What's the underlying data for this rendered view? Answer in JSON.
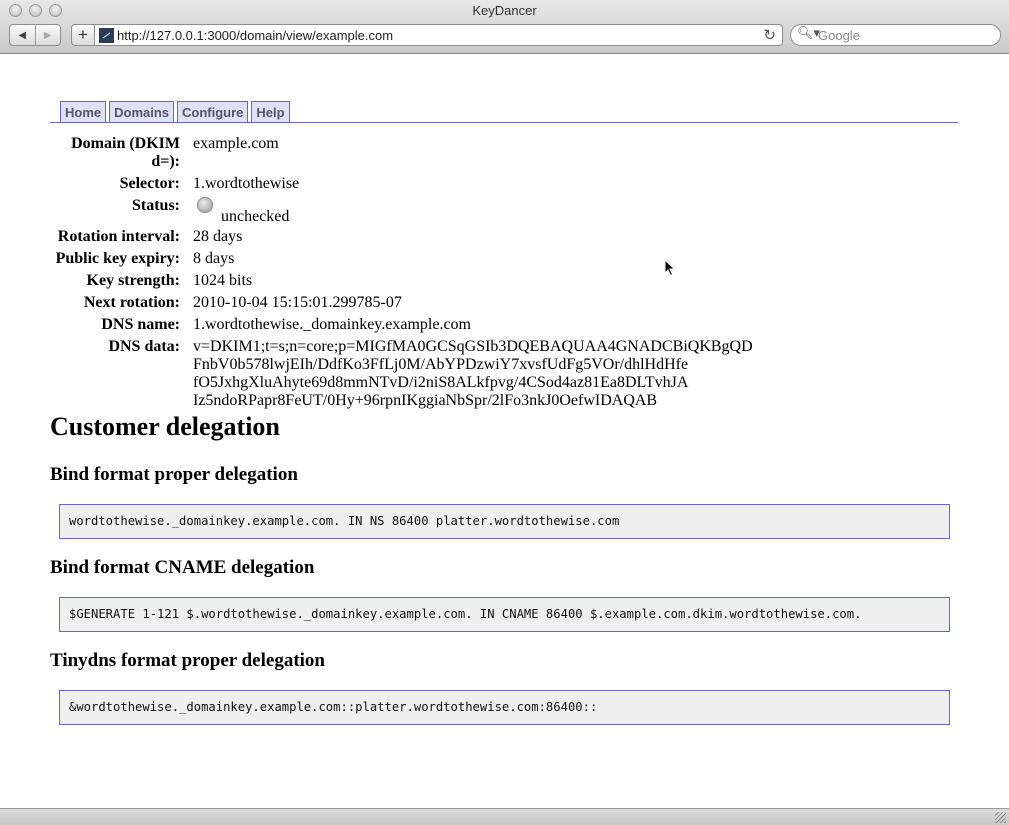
{
  "window": {
    "title": "KeyDancer"
  },
  "toolbar": {
    "url": "http://127.0.0.1:3000/domain/view/example.com",
    "search_placeholder": "Google"
  },
  "nav": {
    "tabs": [
      "Home",
      "Domains",
      "Configure",
      "Help"
    ]
  },
  "details": [
    {
      "label": "Domain (DKIM d=):",
      "value": "example.com"
    },
    {
      "label": "Selector:",
      "value": "1.wordtothewise"
    },
    {
      "label": "Status:",
      "value": "unchecked"
    },
    {
      "label": "Rotation interval:",
      "value": "28 days"
    },
    {
      "label": "Public key expiry:",
      "value": "8 days"
    },
    {
      "label": "Key strength:",
      "value": "1024 bits"
    },
    {
      "label": "Next rotation:",
      "value": "2010-10-04 15:15:01.299785-07"
    },
    {
      "label": "DNS name:",
      "value": "1.wordtothewise._domainkey.example.com"
    },
    {
      "label": "DNS data:",
      "lines": [
        "v=DKIM1;t=s;n=core;p=MIGfMA0GCSqGSIb3DQEBAQUAA4GNADCBiQKBgQD",
        "FnbV0b578lwjEIh/DdfKo3FfLj0M/AbYPDzwiY7xvsfUdFg5VOr/dhlHdHfe",
        "fO5JxhgXluAhyte69d8mmNTvD/i2niS8ALkfpvg/4CSod4az81Ea8DLTvhJA",
        "Iz5ndoRPapr8FeUT/0Hy+96rpnIKggiaNbSpr/2lFo3nkJ0OefwIDAQAB"
      ]
    }
  ],
  "delegation": {
    "heading": "Customer delegation",
    "sections": [
      {
        "title": "Bind format proper delegation",
        "code": "wordtothewise._domainkey.example.com. IN NS 86400 platter.wordtothewise.com"
      },
      {
        "title": "Bind format CNAME delegation",
        "code": "$GENERATE 1-121 $.wordtothewise._domainkey.example.com. IN CNAME 86400 $.example.com.dkim.wordtothewise.com."
      },
      {
        "title": "Tinydns format proper delegation",
        "code": "&wordtothewise._domainkey.example.com::platter.wordtothewise.com:86400::"
      }
    ]
  }
}
